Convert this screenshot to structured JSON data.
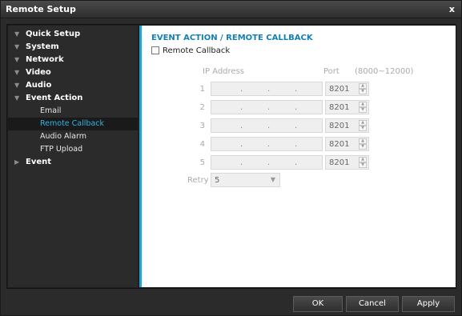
{
  "window": {
    "title": "Remote Setup",
    "close_glyph": "x"
  },
  "sidebar": {
    "items": [
      {
        "label": "Quick Setup",
        "icon": "caret-down-icon"
      },
      {
        "label": "System",
        "icon": "caret-down-icon"
      },
      {
        "label": "Network",
        "icon": "caret-down-icon"
      },
      {
        "label": "Video",
        "icon": "caret-down-icon"
      },
      {
        "label": "Audio",
        "icon": "caret-down-icon"
      },
      {
        "label": "Event Action",
        "icon": "caret-down-icon"
      },
      {
        "label": "Event",
        "icon": "caret-right-icon"
      }
    ],
    "subitems": [
      {
        "label": "Email",
        "active": false
      },
      {
        "label": "Remote Callback",
        "active": true
      },
      {
        "label": "Audio Alarm",
        "active": false
      },
      {
        "label": "FTP Upload",
        "active": false
      }
    ],
    "active_color": "#2db3e6"
  },
  "main": {
    "section_title": "EVENT ACTION / REMOTE CALLBACK",
    "checkbox_label": "Remote Callback",
    "checkbox_checked": false,
    "ip_header": "IP Address",
    "port_header": "Port",
    "port_range": "(8000~12000)",
    "rows": [
      {
        "num": "1",
        "port": "8201"
      },
      {
        "num": "2",
        "port": "8201"
      },
      {
        "num": "3",
        "port": "8201"
      },
      {
        "num": "4",
        "port": "8201"
      },
      {
        "num": "5",
        "port": "8201"
      }
    ],
    "ip_separator": ".",
    "retry_label": "Retry",
    "retry_value": "5",
    "accent_color": "#1aa4d8"
  },
  "footer": {
    "ok": "OK",
    "cancel": "Cancel",
    "apply": "Apply"
  }
}
